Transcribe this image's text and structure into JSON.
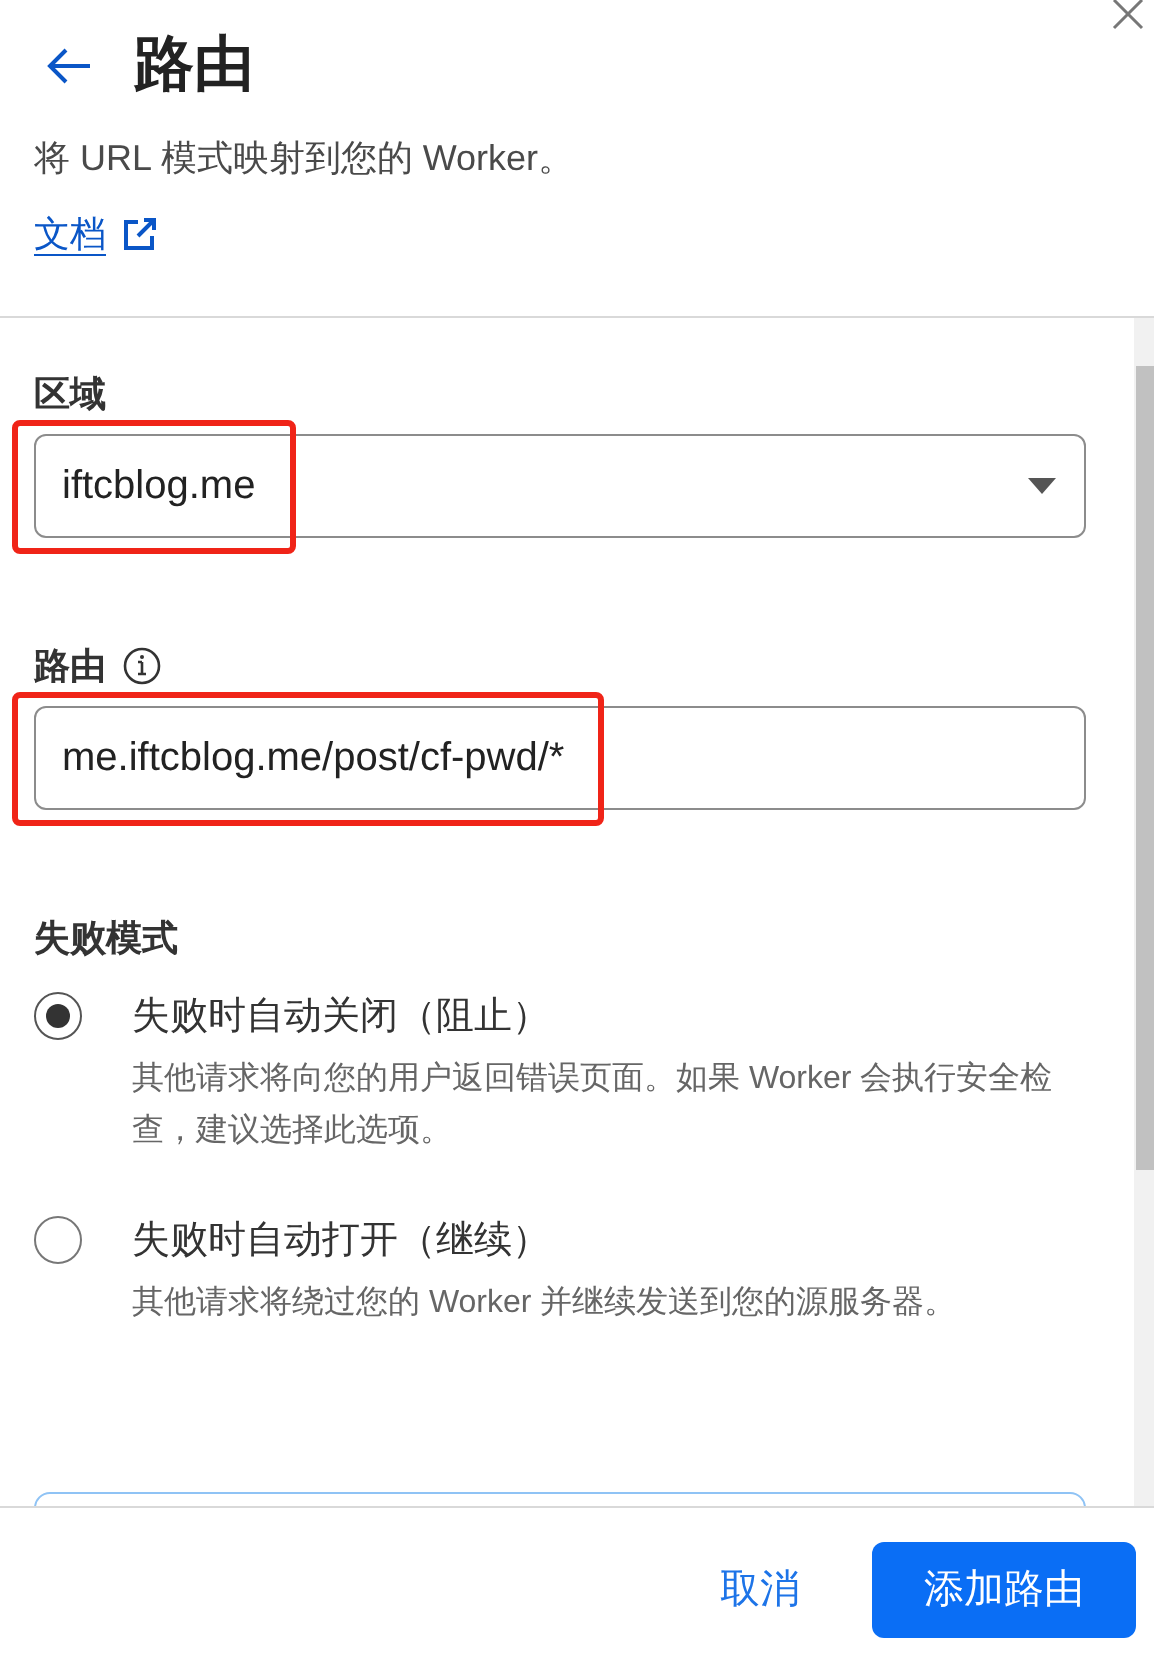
{
  "header": {
    "title": "路由",
    "subtitle": "将 URL 模式映射到您的 Worker。",
    "doc_link": "文档"
  },
  "zone": {
    "label": "区域",
    "value": "iftcblog.me",
    "highlighted": true
  },
  "route": {
    "label": "路由",
    "value": "me.iftcblog.me/post/cf-pwd/*",
    "highlighted": true
  },
  "failure_mode": {
    "label": "失败模式",
    "options": [
      {
        "label": "失败时自动关闭（阻止）",
        "description": "其他请求将向您的用户返回错误页面。如果 Worker 会执行安全检查，建议选择此选项。",
        "selected": true
      },
      {
        "label": "失败时自动打开（继续）",
        "description": "其他请求将绕过您的 Worker 并继续发送到您的源服务器。",
        "selected": false
      }
    ]
  },
  "footer": {
    "cancel": "取消",
    "submit": "添加路由"
  }
}
